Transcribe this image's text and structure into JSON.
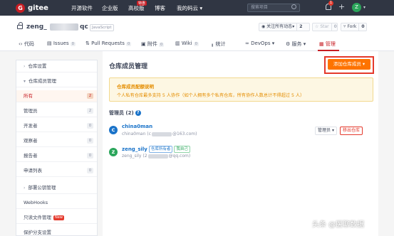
{
  "nav": {
    "logo_text": "gitee",
    "logo_letter": "G",
    "links": [
      "开源软件",
      "企业版",
      "高校版",
      "博客",
      "我的码云"
    ],
    "hot_badge": "特惠",
    "search_placeholder": "搜索项目",
    "notification_count": "1",
    "user_initial": "Z"
  },
  "repo": {
    "owner_prefix": "zeng_",
    "name_suffix": "qc",
    "language": "JavaScript",
    "watch": {
      "label": "关注所有动态",
      "count": "2"
    },
    "star": {
      "label": "Star",
      "count": "0"
    },
    "fork": {
      "label": "Fork",
      "count": "0"
    }
  },
  "tabs": [
    {
      "label": "代码"
    },
    {
      "label": "Issues",
      "count": "0"
    },
    {
      "label": "Pull Requests",
      "count": "0"
    },
    {
      "label": "附件",
      "count": "0"
    },
    {
      "label": "Wiki",
      "count": "0"
    },
    {
      "label": "统计"
    },
    {
      "label": "DevOps"
    },
    {
      "label": "服务"
    },
    {
      "label": "管理",
      "active": true
    }
  ],
  "sidebar": {
    "repo_settings": "仓库设置",
    "members_section": "仓库成员管理",
    "items": [
      {
        "label": "所有",
        "count": "2",
        "active": true
      },
      {
        "label": "管理员",
        "count": "2"
      },
      {
        "label": "开发者",
        "count": "0"
      },
      {
        "label": "观察者",
        "count": "0"
      },
      {
        "label": "报告者",
        "count": "0"
      },
      {
        "label": "申请列表",
        "count": "0"
      }
    ],
    "deploy_keys": "部署公钥管理",
    "webhooks": "WebHooks",
    "readonly_files": "只读文件管理",
    "new_badge": "New",
    "protected_branches": "保护分支设置"
  },
  "main": {
    "title": "仓库成员管理",
    "add_button": "添加仓库成员",
    "notice_title": "仓库成员配额说明",
    "notice_text": "个人私有仓库最多支持 5 人协作（如个人拥有多个私有仓库，所有协作人数总计不得超过 5 人）",
    "admins_heading": "管理员 (2)",
    "members": [
      {
        "name": "china0man",
        "sub_prefix": "china0man (c",
        "sub_suffix": "@163.com)",
        "initial": "C",
        "avatar_color": "#1a73c9",
        "role_button": "管理员",
        "remove_button": "移出仓库"
      },
      {
        "name": "zeng_sily",
        "sub_prefix": "zeng_sily (2",
        "sub_suffix": "@qq.com)",
        "initial": "Z",
        "avatar_color": "#2aa55a",
        "tags": [
          "仓库所有者",
          "我自己"
        ]
      }
    ]
  },
  "watermark": "头条 @医聊数据"
}
